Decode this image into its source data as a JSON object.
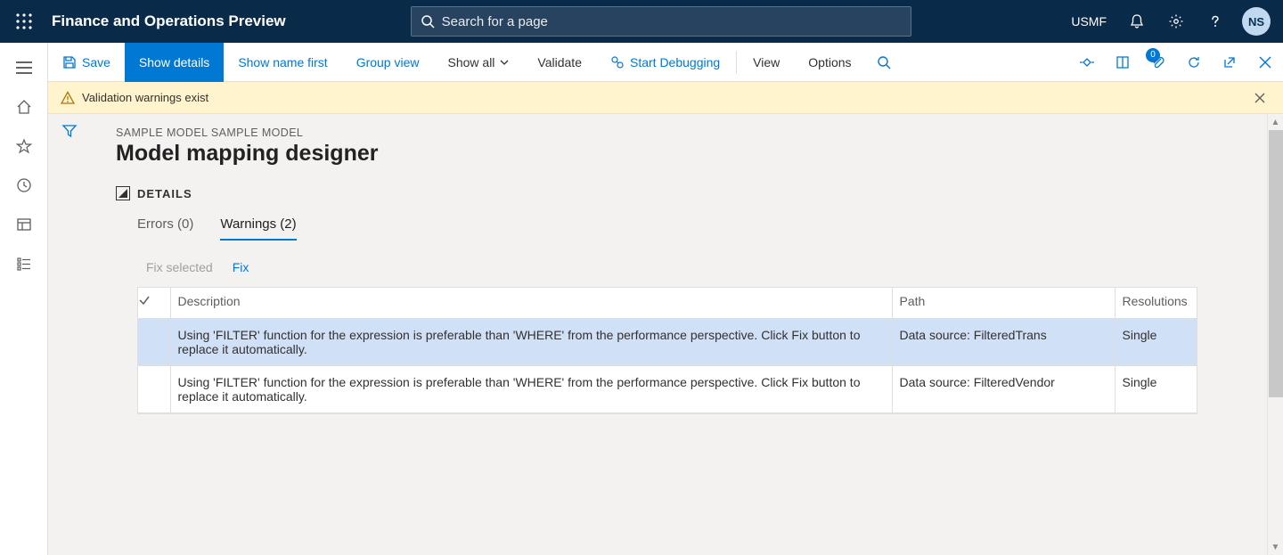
{
  "topbar": {
    "app_title": "Finance and Operations Preview",
    "search_placeholder": "Search for a page",
    "company": "USMF",
    "avatar_initials": "NS"
  },
  "actionbar": {
    "save": "Save",
    "show_details": "Show details",
    "show_name_first": "Show name first",
    "group_view": "Group view",
    "show_all": "Show all",
    "validate": "Validate",
    "start_debugging": "Start Debugging",
    "view": "View",
    "options": "Options",
    "attachment_badge": "0"
  },
  "banner": {
    "message": "Validation warnings exist"
  },
  "page": {
    "breadcrumb": "SAMPLE MODEL SAMPLE MODEL",
    "title": "Model mapping designer",
    "details_label": "DETAILS"
  },
  "tabs": {
    "errors_label": "Errors (0)",
    "warnings_label": "Warnings (2)"
  },
  "subbar": {
    "fix_selected": "Fix selected",
    "fix": "Fix"
  },
  "grid": {
    "headers": {
      "description": "Description",
      "path": "Path",
      "resolutions": "Resolutions"
    },
    "rows": [
      {
        "description": "Using 'FILTER' function for the expression is preferable than 'WHERE' from the performance perspective. Click Fix button to replace it automatically.",
        "path": "Data source: FilteredTrans",
        "resolutions": "Single",
        "selected": true
      },
      {
        "description": "Using 'FILTER' function for the expression is preferable than 'WHERE' from the performance perspective. Click Fix button to replace it automatically.",
        "path": "Data source: FilteredVendor",
        "resolutions": "Single",
        "selected": false
      }
    ]
  }
}
